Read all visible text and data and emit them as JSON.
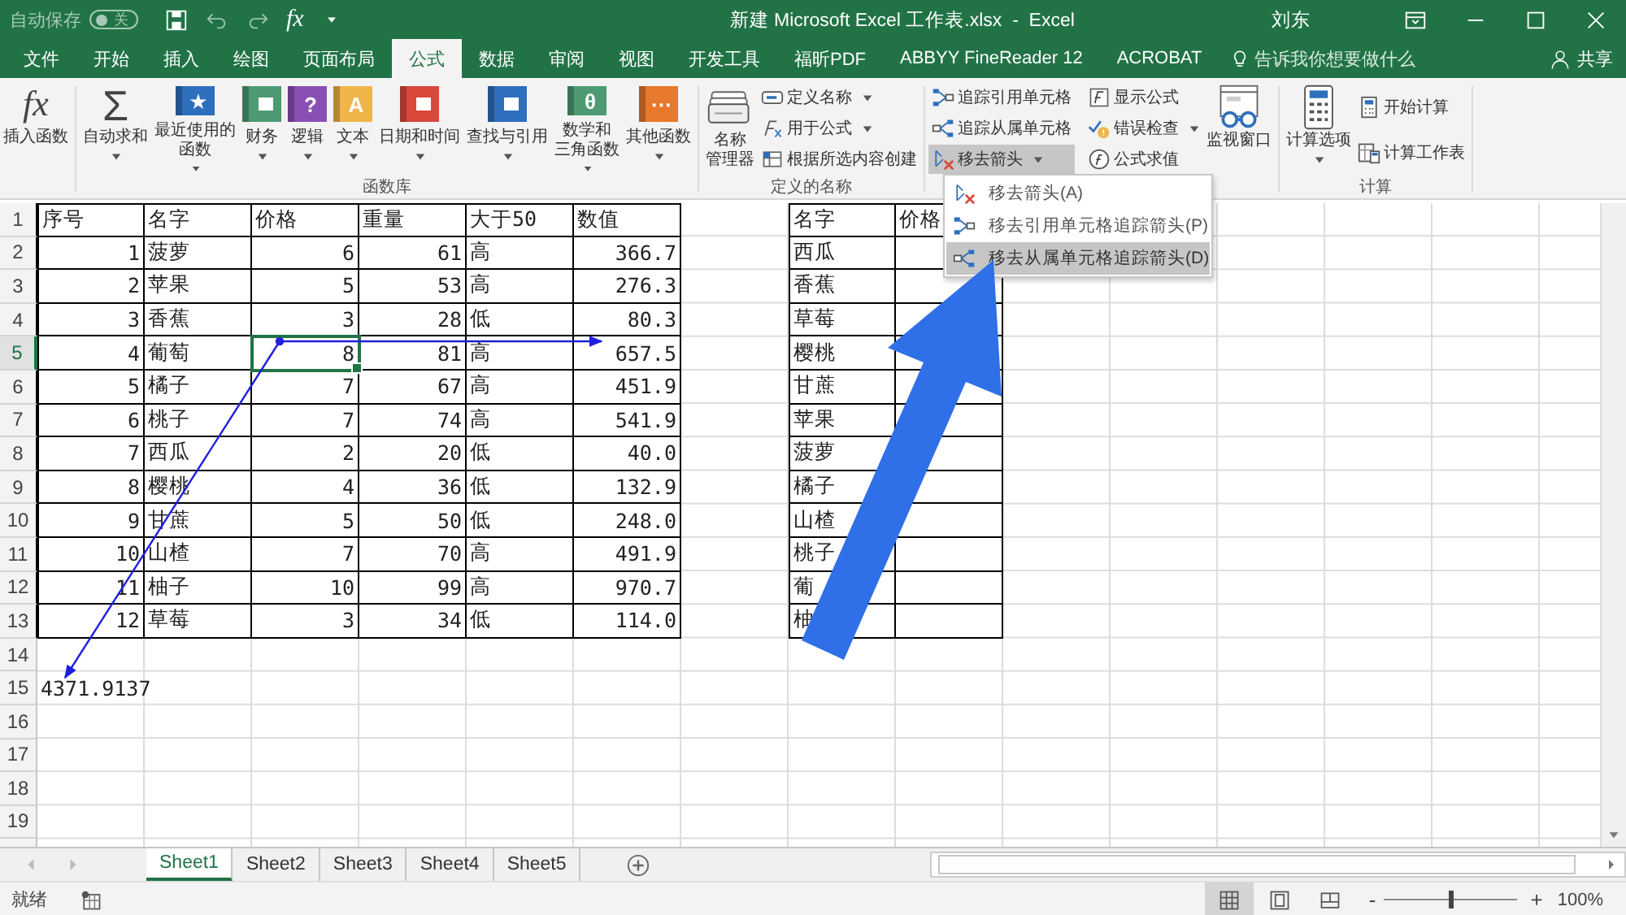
{
  "title_bar": {
    "autosave": {
      "label": "自动保存",
      "state_text": "关",
      "on": false
    },
    "formula_glyph": "fx",
    "title": "新建 Microsoft Excel 工作表.xlsx  -  Excel",
    "user": "刘东"
  },
  "ribbon_tabs": [
    {
      "label": "文件",
      "selected": false
    },
    {
      "label": "开始",
      "selected": false
    },
    {
      "label": "插入",
      "selected": false
    },
    {
      "label": "绘图",
      "selected": false
    },
    {
      "label": "页面布局",
      "selected": false
    },
    {
      "label": "公式",
      "selected": true
    },
    {
      "label": "数据",
      "selected": false
    },
    {
      "label": "审阅",
      "selected": false
    },
    {
      "label": "视图",
      "selected": false
    },
    {
      "label": "开发工具",
      "selected": false
    },
    {
      "label": "福昕PDF",
      "selected": false
    },
    {
      "label": "ABBYY FineReader 12",
      "selected": false
    },
    {
      "label": "ACROBAT",
      "selected": false
    }
  ],
  "tell_me": "告诉我你想要做什么",
  "share": "共享",
  "ribbon": {
    "insert_function": {
      "glyph": "fx",
      "label": "插入函数"
    },
    "function_library": {
      "label": "函数库",
      "buttons": [
        {
          "kind": "plain",
          "glyph": "Σ",
          "color": "#444444",
          "lines": [
            "自动求和"
          ]
        },
        {
          "kind": "book",
          "glyph": "★",
          "color": "#2e6fbd",
          "lines": [
            "最近使用的",
            "函数"
          ]
        },
        {
          "kind": "book",
          "color": "#4e9a72",
          "lines": [
            "财务"
          ]
        },
        {
          "kind": "book",
          "glyph": "?",
          "color": "#8a4fb5",
          "lines": [
            "逻辑"
          ]
        },
        {
          "kind": "book",
          "glyph": "A",
          "color": "#f0b54a",
          "lines": [
            "文本"
          ]
        },
        {
          "kind": "book",
          "color": "#d9483b",
          "lines": [
            "日期和时间"
          ]
        },
        {
          "kind": "book",
          "color": "#2e6fbd",
          "lines": [
            "查找与引用"
          ]
        },
        {
          "kind": "book",
          "glyph": "θ",
          "color": "#4e9a72",
          "lines": [
            "数学和",
            "三角函数"
          ]
        },
        {
          "kind": "book",
          "glyph": "···",
          "color": "#e8782b",
          "lines": [
            "其他函数"
          ]
        }
      ]
    },
    "defined_names": {
      "label": "定义的名称",
      "manager_lines": [
        "名称",
        "管理器"
      ],
      "items": [
        {
          "label": "定义名称",
          "dropdown": true
        },
        {
          "label": "用于公式",
          "dropdown": true
        },
        {
          "label": "根据所选内容创建",
          "dropdown": false
        }
      ]
    },
    "auditing": {
      "items": [
        {
          "label": "追踪引用单元格",
          "dropdown": false,
          "pressed": false
        },
        {
          "label": "追踪从属单元格",
          "dropdown": false,
          "pressed": false
        },
        {
          "label": "移去箭头",
          "dropdown": true,
          "pressed": true
        },
        {
          "label": "显示公式",
          "dropdown": false,
          "pressed": false
        },
        {
          "label": "错误检查",
          "dropdown": true,
          "pressed": false
        },
        {
          "label": "公式求值",
          "dropdown": false,
          "pressed": false
        }
      ],
      "watch_window": "监视窗口"
    },
    "calculation": {
      "label": "计算",
      "options_label": "计算选项",
      "items": [
        "开始计算",
        "计算工作表"
      ]
    }
  },
  "remove_arrows_menu": [
    {
      "label": "移去箭头(A)",
      "selected": false
    },
    {
      "label": "移去引用单元格追踪箭头(P)",
      "selected": false
    },
    {
      "label": "移去从属单元格追踪箭头(D)",
      "selected": true
    }
  ],
  "sheet": {
    "row_headers": [
      {
        "label": "1",
        "selected": false
      },
      {
        "label": "2",
        "selected": false
      },
      {
        "label": "3",
        "selected": false
      },
      {
        "label": "4",
        "selected": false
      },
      {
        "label": "5",
        "selected": true
      },
      {
        "label": "6",
        "selected": false
      },
      {
        "label": "7",
        "selected": false
      },
      {
        "label": "8",
        "selected": false
      },
      {
        "label": "9",
        "selected": false
      },
      {
        "label": "10",
        "selected": false
      },
      {
        "label": "11",
        "selected": false
      },
      {
        "label": "12",
        "selected": false
      },
      {
        "label": "13",
        "selected": false
      },
      {
        "label": "14",
        "selected": false
      },
      {
        "label": "15",
        "selected": false
      },
      {
        "label": "16",
        "selected": false
      },
      {
        "label": "17",
        "selected": false
      },
      {
        "label": "18",
        "selected": false
      },
      {
        "label": "19",
        "selected": false
      }
    ],
    "table_1": {
      "columns": [
        {
          "header": "序号",
          "kind": "number"
        },
        {
          "header": "名字",
          "kind": "text"
        },
        {
          "header": "价格",
          "kind": "number"
        },
        {
          "header": "重量",
          "kind": "number"
        },
        {
          "header": "大于50",
          "kind": "text"
        },
        {
          "header": "数值",
          "kind": "number"
        }
      ],
      "rows": [
        {
          "cells": [
            {
              "text": "1",
              "selected": false
            },
            {
              "text": "菠萝",
              "selected": false
            },
            {
              "text": "6",
              "selected": false
            },
            {
              "text": "61",
              "selected": false
            },
            {
              "text": "高",
              "selected": false
            },
            {
              "text": "366.7",
              "selected": false
            }
          ]
        },
        {
          "cells": [
            {
              "text": "2",
              "selected": false
            },
            {
              "text": "苹果",
              "selected": false
            },
            {
              "text": "5",
              "selected": false
            },
            {
              "text": "53",
              "selected": false
            },
            {
              "text": "高",
              "selected": false
            },
            {
              "text": "276.3",
              "selected": false
            }
          ]
        },
        {
          "cells": [
            {
              "text": "3",
              "selected": false
            },
            {
              "text": "香蕉",
              "selected": false
            },
            {
              "text": "3",
              "selected": false
            },
            {
              "text": "28",
              "selected": false
            },
            {
              "text": "低",
              "selected": false
            },
            {
              "text": "80.3",
              "selected": false
            }
          ]
        },
        {
          "cells": [
            {
              "text": "4",
              "selected": false
            },
            {
              "text": "葡萄",
              "selected": false
            },
            {
              "text": "8",
              "selected": true
            },
            {
              "text": "81",
              "selected": false
            },
            {
              "text": "高",
              "selected": false
            },
            {
              "text": "657.5",
              "selected": false
            }
          ]
        },
        {
          "cells": [
            {
              "text": "5",
              "selected": false
            },
            {
              "text": "橘子",
              "selected": false
            },
            {
              "text": "7",
              "selected": false
            },
            {
              "text": "67",
              "selected": false
            },
            {
              "text": "高",
              "selected": false
            },
            {
              "text": "451.9",
              "selected": false
            }
          ]
        },
        {
          "cells": [
            {
              "text": "6",
              "selected": false
            },
            {
              "text": "桃子",
              "selected": false
            },
            {
              "text": "7",
              "selected": false
            },
            {
              "text": "74",
              "selected": false
            },
            {
              "text": "高",
              "selected": false
            },
            {
              "text": "541.9",
              "selected": false
            }
          ]
        },
        {
          "cells": [
            {
              "text": "7",
              "selected": false
            },
            {
              "text": "西瓜",
              "selected": false
            },
            {
              "text": "2",
              "selected": false
            },
            {
              "text": "20",
              "selected": false
            },
            {
              "text": "低",
              "selected": false
            },
            {
              "text": "40.0",
              "selected": false
            }
          ]
        },
        {
          "cells": [
            {
              "text": "8",
              "selected": false
            },
            {
              "text": "樱桃",
              "selected": false
            },
            {
              "text": "4",
              "selected": false
            },
            {
              "text": "36",
              "selected": false
            },
            {
              "text": "低",
              "selected": false
            },
            {
              "text": "132.9",
              "selected": false
            }
          ]
        },
        {
          "cells": [
            {
              "text": "9",
              "selected": false
            },
            {
              "text": "甘蔗",
              "selected": false
            },
            {
              "text": "5",
              "selected": false
            },
            {
              "text": "50",
              "selected": false
            },
            {
              "text": "低",
              "selected": false
            },
            {
              "text": "248.0",
              "selected": false
            }
          ]
        },
        {
          "cells": [
            {
              "text": "10",
              "selected": false
            },
            {
              "text": "山楂",
              "selected": false
            },
            {
              "text": "7",
              "selected": false
            },
            {
              "text": "70",
              "selected": false
            },
            {
              "text": "高",
              "selected": false
            },
            {
              "text": "491.9",
              "selected": false
            }
          ]
        },
        {
          "cells": [
            {
              "text": "11",
              "selected": false
            },
            {
              "text": "柚子",
              "selected": false
            },
            {
              "text": "10",
              "selected": false
            },
            {
              "text": "99",
              "selected": false
            },
            {
              "text": "高",
              "selected": false
            },
            {
              "text": "970.7",
              "selected": false
            }
          ]
        },
        {
          "cells": [
            {
              "text": "12",
              "selected": false
            },
            {
              "text": "草莓",
              "selected": false
            },
            {
              "text": "3",
              "selected": false
            },
            {
              "text": "34",
              "selected": false
            },
            {
              "text": "低",
              "selected": false
            },
            {
              "text": "114.0",
              "selected": false
            }
          ]
        }
      ]
    },
    "table_2": {
      "columns": [
        "名字",
        "价格"
      ],
      "rows": [
        "西瓜",
        "香蕉",
        "草莓",
        "樱桃",
        "甘蔗",
        "苹果",
        "菠萝",
        "橘子",
        "山楂",
        "桃子",
        "葡",
        "柚"
      ]
    },
    "result_cell": {
      "text": "4371.9137"
    }
  },
  "sheet_tabs": [
    {
      "label": "Sheet1",
      "selected": true
    },
    {
      "label": "Sheet2",
      "selected": false
    },
    {
      "label": "Sheet3",
      "selected": false
    },
    {
      "label": "Sheet4",
      "selected": false
    },
    {
      "label": "Sheet5",
      "selected": false
    }
  ],
  "status_bar": {
    "status": "就绪",
    "views": [
      {
        "selected": true
      },
      {
        "selected": false
      },
      {
        "selected": false
      }
    ],
    "zoom": {
      "minus": "-",
      "plus": "+",
      "level": 0.5,
      "reading": "100%"
    }
  }
}
